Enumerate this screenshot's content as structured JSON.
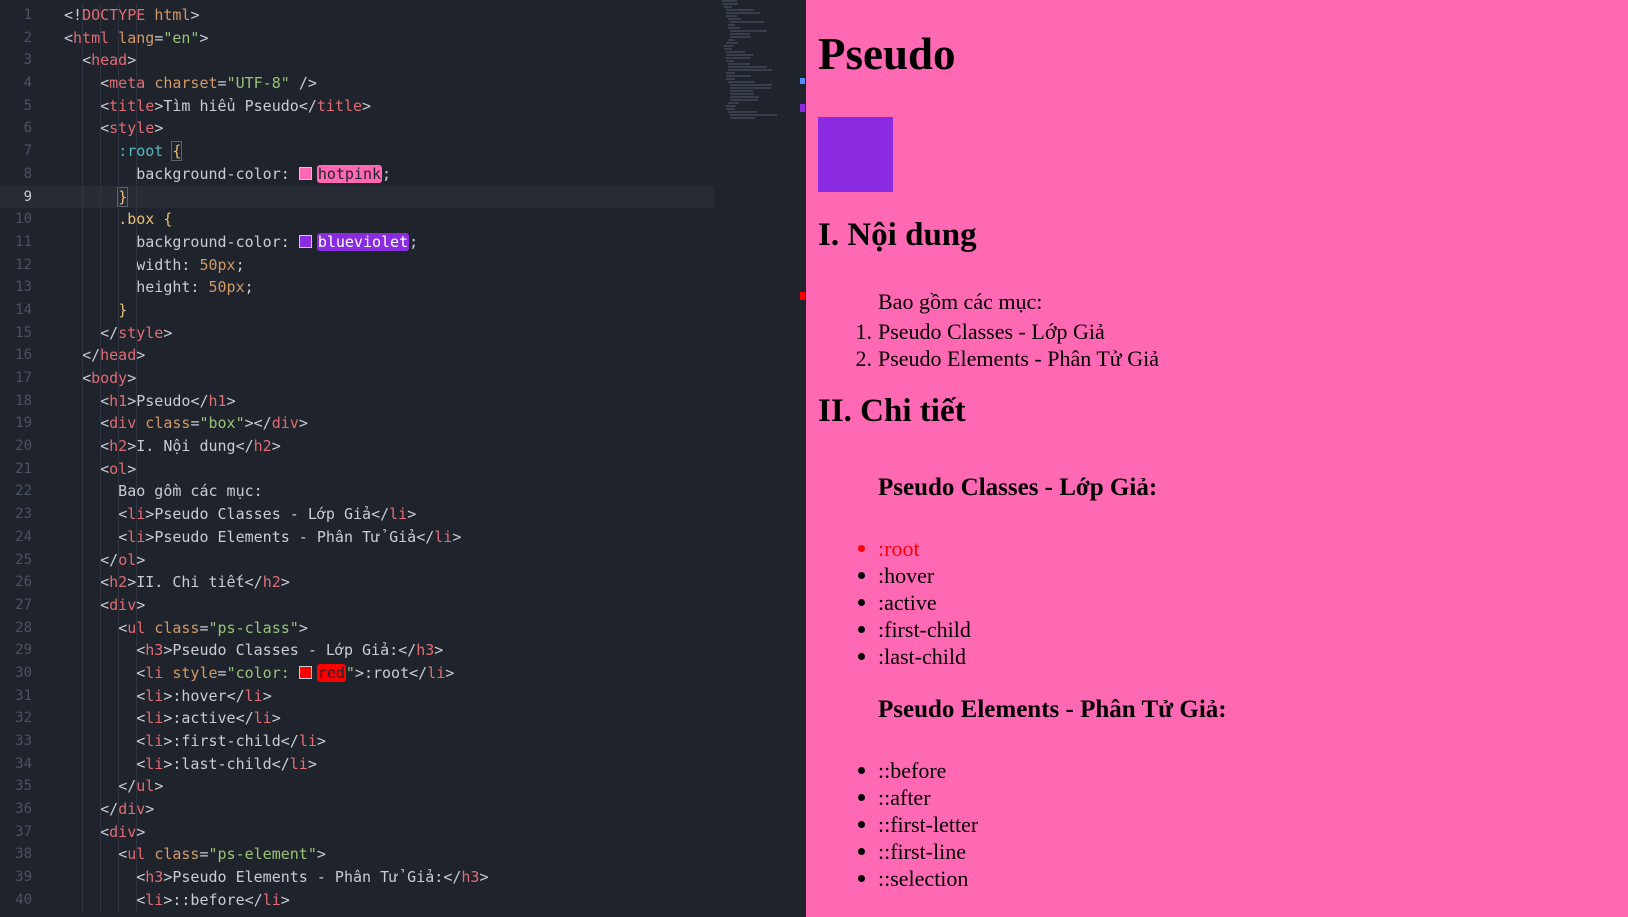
{
  "editor": {
    "lines": [
      {
        "n": "1",
        "html": "<span class=\"t-punc\">&lt;!</span><span class=\"t-tag\">DOCTYPE</span> <span class=\"t-attr\">html</span><span class=\"t-punc\">&gt;</span>"
      },
      {
        "n": "2",
        "html": "<span class=\"t-punc\">&lt;</span><span class=\"t-tag\">html</span> <span class=\"t-attr\">lang</span><span class=\"t-punc\">=</span><span class=\"t-str\">\"en\"</span><span class=\"t-punc\">&gt;</span>"
      },
      {
        "n": "3",
        "html": "  <span class=\"t-punc\">&lt;</span><span class=\"t-tag\">head</span><span class=\"t-punc\">&gt;</span>"
      },
      {
        "n": "4",
        "html": "    <span class=\"t-punc\">&lt;</span><span class=\"t-tag\">meta</span> <span class=\"t-attr\">charset</span><span class=\"t-punc\">=</span><span class=\"t-str\">\"UTF-8\"</span> <span class=\"t-punc\">/&gt;</span>"
      },
      {
        "n": "5",
        "html": "    <span class=\"t-punc\">&lt;</span><span class=\"t-tag\">title</span><span class=\"t-punc\">&gt;</span>Tìm hiểu Pseudo<span class=\"t-punc\">&lt;/</span><span class=\"t-tag\">title</span><span class=\"t-punc\">&gt;</span>"
      },
      {
        "n": "6",
        "html": "    <span class=\"t-punc\">&lt;</span><span class=\"t-tag\">style</span><span class=\"t-punc\">&gt;</span>"
      },
      {
        "n": "7",
        "html": "      <span class=\"t-sel\">:root</span> <span class=\"t-brace\" style=\"outline:1px solid #5c6370\">{</span>"
      },
      {
        "n": "8",
        "html": "        background-color: <span class=\"swatch\" style=\"background:hotpink\"></span><span class=\"chip\" style=\"background:hotpink;color:#1f232b\">hotpink</span>;"
      },
      {
        "n": "9",
        "html": "      <span class=\"t-brace\" style=\"outline:1px solid #5c6370\">}</span>",
        "active": true
      },
      {
        "n": "10",
        "html": "      <span class=\"t-cls\">.box</span> <span class=\"t-brace\">{</span>"
      },
      {
        "n": "11",
        "html": "        background-color: <span class=\"swatch\" style=\"background:blueviolet\"></span><span class=\"chip\" style=\"background:blueviolet;color:#ffffff\">blueviolet</span>;"
      },
      {
        "n": "12",
        "html": "        width: <span class=\"t-num\">50px</span>;"
      },
      {
        "n": "13",
        "html": "        height: <span class=\"t-num\">50px</span>;"
      },
      {
        "n": "14",
        "html": "      <span class=\"t-brace\">}</span>"
      },
      {
        "n": "15",
        "html": "    <span class=\"t-punc\">&lt;/</span><span class=\"t-tag\">style</span><span class=\"t-punc\">&gt;</span>"
      },
      {
        "n": "16",
        "html": "  <span class=\"t-punc\">&lt;/</span><span class=\"t-tag\">head</span><span class=\"t-punc\">&gt;</span>"
      },
      {
        "n": "17",
        "html": "  <span class=\"t-punc\">&lt;</span><span class=\"t-tag\">body</span><span class=\"t-punc\">&gt;</span>"
      },
      {
        "n": "18",
        "html": "    <span class=\"t-punc\">&lt;</span><span class=\"t-tag\">h1</span><span class=\"t-punc\">&gt;</span>Pseudo<span class=\"t-punc\">&lt;/</span><span class=\"t-tag\">h1</span><span class=\"t-punc\">&gt;</span>"
      },
      {
        "n": "19",
        "html": "    <span class=\"t-punc\">&lt;</span><span class=\"t-tag\">div</span> <span class=\"t-attr\">class</span><span class=\"t-punc\">=</span><span class=\"t-str\">\"box\"</span><span class=\"t-punc\">&gt;&lt;/</span><span class=\"t-tag\">div</span><span class=\"t-punc\">&gt;</span>"
      },
      {
        "n": "20",
        "html": "    <span class=\"t-punc\">&lt;</span><span class=\"t-tag\">h2</span><span class=\"t-punc\">&gt;</span>I. Nội dung<span class=\"t-punc\">&lt;/</span><span class=\"t-tag\">h2</span><span class=\"t-punc\">&gt;</span>"
      },
      {
        "n": "21",
        "html": "    <span class=\"t-punc\">&lt;</span><span class=\"t-tag\">ol</span><span class=\"t-punc\">&gt;</span>"
      },
      {
        "n": "22",
        "html": "      Bao gồm các mục:"
      },
      {
        "n": "23",
        "html": "      <span class=\"t-punc\">&lt;</span><span class=\"t-tag\">li</span><span class=\"t-punc\">&gt;</span>Pseudo Classes - Lớp Giả<span class=\"t-punc\">&lt;/</span><span class=\"t-tag\">li</span><span class=\"t-punc\">&gt;</span>"
      },
      {
        "n": "24",
        "html": "      <span class=\"t-punc\">&lt;</span><span class=\"t-tag\">li</span><span class=\"t-punc\">&gt;</span>Pseudo Elements - Phân Tử Giả<span class=\"t-punc\">&lt;/</span><span class=\"t-tag\">li</span><span class=\"t-punc\">&gt;</span>"
      },
      {
        "n": "25",
        "html": "    <span class=\"t-punc\">&lt;/</span><span class=\"t-tag\">ol</span><span class=\"t-punc\">&gt;</span>"
      },
      {
        "n": "26",
        "html": "    <span class=\"t-punc\">&lt;</span><span class=\"t-tag\">h2</span><span class=\"t-punc\">&gt;</span>II. Chi tiết<span class=\"t-punc\">&lt;/</span><span class=\"t-tag\">h2</span><span class=\"t-punc\">&gt;</span>"
      },
      {
        "n": "27",
        "html": "    <span class=\"t-punc\">&lt;</span><span class=\"t-tag\">div</span><span class=\"t-punc\">&gt;</span>"
      },
      {
        "n": "28",
        "html": "      <span class=\"t-punc\">&lt;</span><span class=\"t-tag\">ul</span> <span class=\"t-attr\">class</span><span class=\"t-punc\">=</span><span class=\"t-str\">\"ps-class\"</span><span class=\"t-punc\">&gt;</span>"
      },
      {
        "n": "29",
        "html": "        <span class=\"t-punc\">&lt;</span><span class=\"t-tag\">h3</span><span class=\"t-punc\">&gt;</span>Pseudo Classes - Lớp Giả:<span class=\"t-punc\">&lt;/</span><span class=\"t-tag\">h3</span><span class=\"t-punc\">&gt;</span>"
      },
      {
        "n": "30",
        "html": "        <span class=\"t-punc\">&lt;</span><span class=\"t-tag\">li</span> <span class=\"t-attr\">style</span><span class=\"t-punc\">=</span><span class=\"t-str\">\"color: </span><span class=\"swatch\" style=\"background:red\"></span><span class=\"chip\" style=\"background:red;color:#1f232b\">red</span><span class=\"t-str\">\"</span><span class=\"t-punc\">&gt;</span>:root<span class=\"t-punc\">&lt;/</span><span class=\"t-tag\">li</span><span class=\"t-punc\">&gt;</span>"
      },
      {
        "n": "31",
        "html": "        <span class=\"t-punc\">&lt;</span><span class=\"t-tag\">li</span><span class=\"t-punc\">&gt;</span>:hover<span class=\"t-punc\">&lt;/</span><span class=\"t-tag\">li</span><span class=\"t-punc\">&gt;</span>"
      },
      {
        "n": "32",
        "html": "        <span class=\"t-punc\">&lt;</span><span class=\"t-tag\">li</span><span class=\"t-punc\">&gt;</span>:active<span class=\"t-punc\">&lt;/</span><span class=\"t-tag\">li</span><span class=\"t-punc\">&gt;</span>"
      },
      {
        "n": "33",
        "html": "        <span class=\"t-punc\">&lt;</span><span class=\"t-tag\">li</span><span class=\"t-punc\">&gt;</span>:first-child<span class=\"t-punc\">&lt;/</span><span class=\"t-tag\">li</span><span class=\"t-punc\">&gt;</span>"
      },
      {
        "n": "34",
        "html": "        <span class=\"t-punc\">&lt;</span><span class=\"t-tag\">li</span><span class=\"t-punc\">&gt;</span>:last-child<span class=\"t-punc\">&lt;/</span><span class=\"t-tag\">li</span><span class=\"t-punc\">&gt;</span>"
      },
      {
        "n": "35",
        "html": "      <span class=\"t-punc\">&lt;/</span><span class=\"t-tag\">ul</span><span class=\"t-punc\">&gt;</span>"
      },
      {
        "n": "36",
        "html": "    <span class=\"t-punc\">&lt;/</span><span class=\"t-tag\">div</span><span class=\"t-punc\">&gt;</span>"
      },
      {
        "n": "37",
        "html": "    <span class=\"t-punc\">&lt;</span><span class=\"t-tag\">div</span><span class=\"t-punc\">&gt;</span>"
      },
      {
        "n": "38",
        "html": "      <span class=\"t-punc\">&lt;</span><span class=\"t-tag\">ul</span> <span class=\"t-attr\">class</span><span class=\"t-punc\">=</span><span class=\"t-str\">\"ps-element\"</span><span class=\"t-punc\">&gt;</span>"
      },
      {
        "n": "39",
        "html": "        <span class=\"t-punc\">&lt;</span><span class=\"t-tag\">h3</span><span class=\"t-punc\">&gt;</span>Pseudo Elements - Phân Tử Giả:<span class=\"t-punc\">&lt;/</span><span class=\"t-tag\">h3</span><span class=\"t-punc\">&gt;</span>"
      },
      {
        "n": "40",
        "html": "        <span class=\"t-punc\">&lt;</span><span class=\"t-tag\">li</span><span class=\"t-punc\">&gt;</span>::before<span class=\"t-punc\">&lt;/</span><span class=\"t-tag\">li</span><span class=\"t-punc\">&gt;</span>"
      }
    ]
  },
  "preview": {
    "h1": "Pseudo",
    "box_color": "blueviolet",
    "background_color": "hotpink",
    "section1_title": "I. Nội dung",
    "ol_intro": "Bao gồm các mục:",
    "ol_items": [
      {
        "num": "1.",
        "text": "Pseudo Classes - Lớp Giả"
      },
      {
        "num": "2.",
        "text": "Pseudo Elements - Phân Tử Giả"
      }
    ],
    "section2_title": "II. Chi tiết",
    "classes_title": "Pseudo Classes - Lớp Giả:",
    "classes_items": [
      {
        "text": ":root",
        "color": "red"
      },
      {
        "text": ":hover"
      },
      {
        "text": ":active"
      },
      {
        "text": ":first-child"
      },
      {
        "text": ":last-child"
      }
    ],
    "elements_title": "Pseudo Elements - Phân Tử Giả:",
    "elements_items": [
      {
        "text": "::before"
      },
      {
        "text": "::after"
      },
      {
        "text": "::first-letter"
      },
      {
        "text": "::first-line"
      },
      {
        "text": "::selection"
      }
    ]
  }
}
